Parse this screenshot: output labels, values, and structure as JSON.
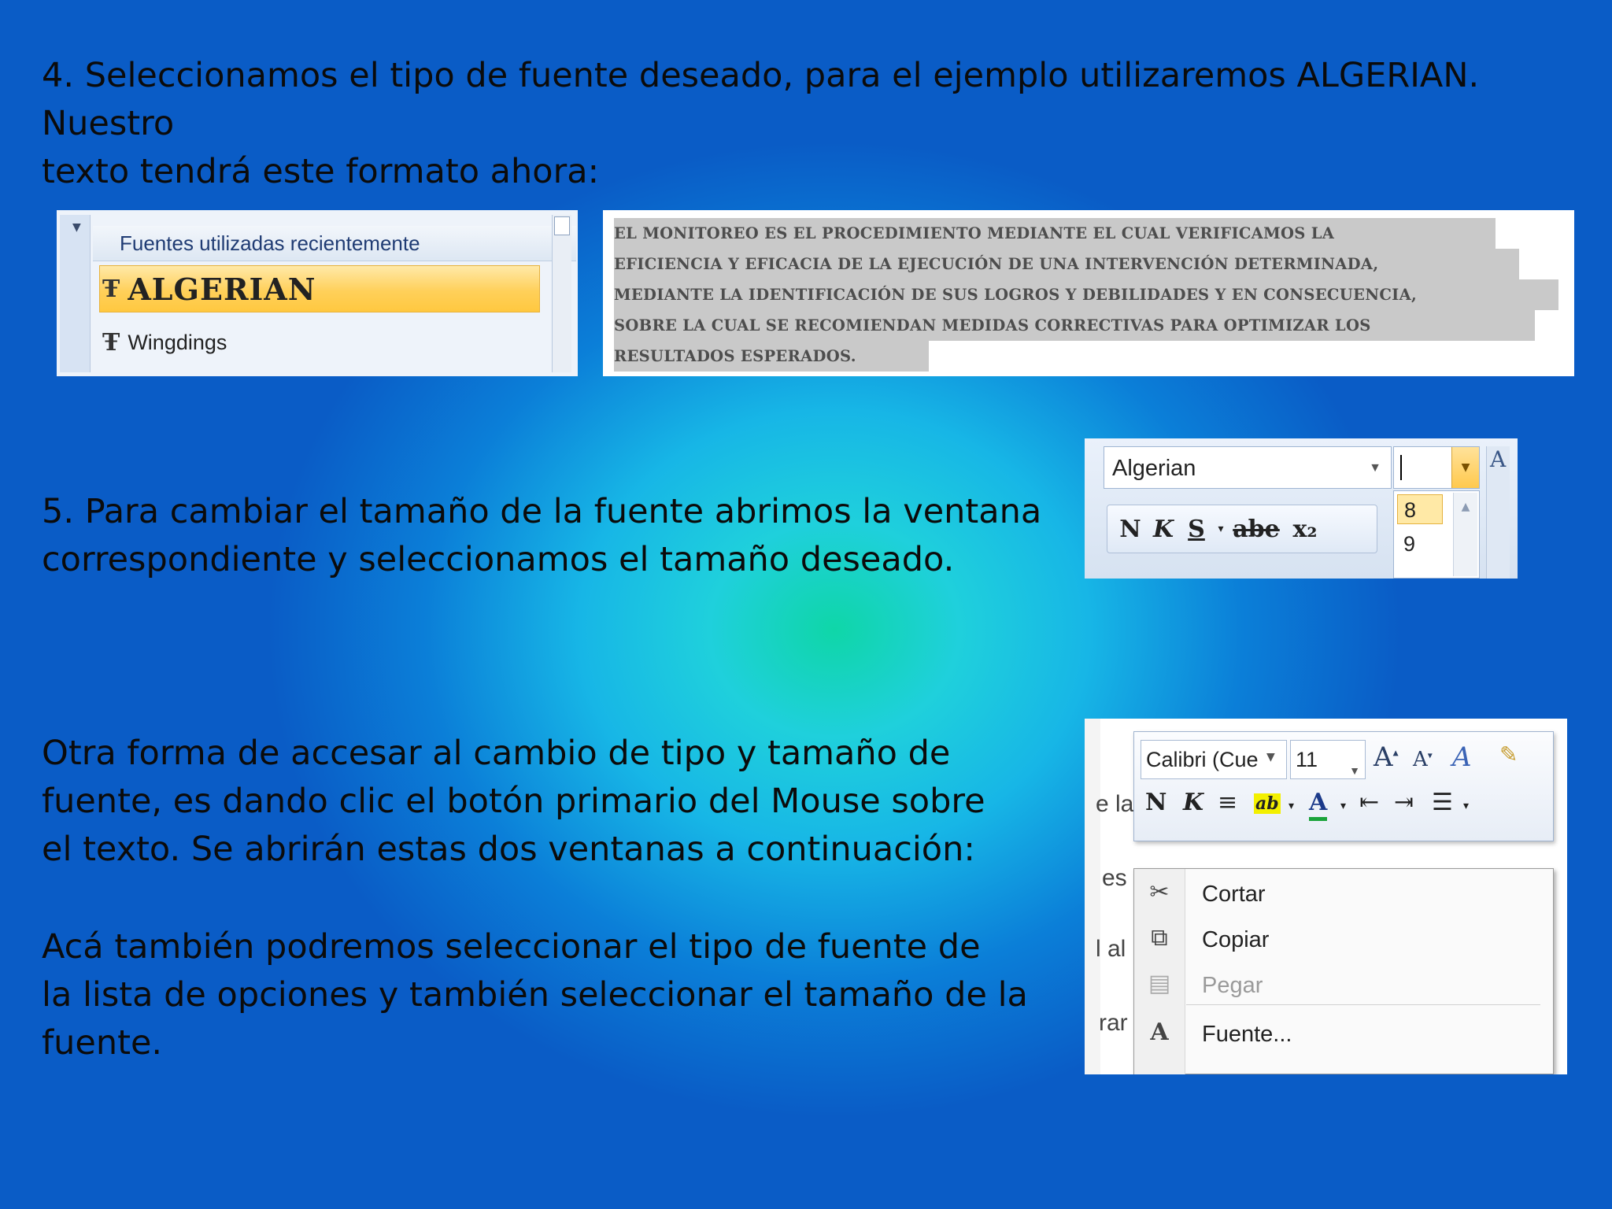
{
  "step4": {
    "line1": "4. Seleccionamos el tipo de fuente deseado, para el ejemplo utilizaremos ALGERIAN. Nuestro",
    "line2": "texto tendrá este formato ahora:"
  },
  "recent_fonts": {
    "header": "Fuentes utilizadas recientemente",
    "items": [
      {
        "label": "ALGERIAN",
        "selected": true
      },
      {
        "label": "Wingdings",
        "selected": false
      }
    ]
  },
  "sample_text": {
    "lines": [
      "EL MONITOREO ES EL PROCEDIMIENTO MEDIANTE EL CUAL VERIFICAMOS LA",
      "EFICIENCIA Y EFICACIA DE  LA EJECUCIÓN DE UNA INTERVENCIÓN DETERMINADA,",
      "MEDIANTE LA IDENTIFICACIÓN DE SUS LOGROS Y DEBILIDADES Y EN CONSECUENCIA,",
      "SOBRE LA CUAL SE RECOMIENDAN MEDIDAS CORRECTIVAS PARA OPTIMIZAR LOS",
      "RESULTADOS ESPERADOS."
    ]
  },
  "step5": {
    "line1": "5. Para cambiar el tamaño de la fuente abrimos la ventana",
    "line2": "correspondiente y seleccionamos el tamaño deseado."
  },
  "font_combo": {
    "font_name": "Algerian",
    "buttons": [
      "N",
      "K",
      "S",
      "abe",
      "x₂"
    ],
    "size_options": [
      "8",
      "9"
    ],
    "selected_size": "8"
  },
  "para_other": {
    "line1": "Otra forma de accesar al cambio de tipo y tamaño de",
    "line2": "fuente, es dando clic el botón primario del Mouse sobre",
    "line3": "el texto. Se abrirán estas dos ventanas a continuación:"
  },
  "para_also": {
    "line1": "Acá también podremos seleccionar el tipo de fuente de",
    "line2": "la lista de opciones y también seleccionar el tamaño de la",
    "line3": "fuente."
  },
  "mini_toolbar": {
    "font": "Calibri (Cue",
    "size": "11",
    "row2": [
      "N",
      "K"
    ]
  },
  "context_menu": {
    "items": [
      {
        "label": "Cortar",
        "icon": "scissors-icon",
        "disabled": false
      },
      {
        "label": "Copiar",
        "icon": "copy-icon",
        "disabled": false
      },
      {
        "label": "Pegar",
        "icon": "paste-icon",
        "disabled": true
      },
      {
        "label": "Fuente...",
        "icon": "font-icon",
        "disabled": false
      }
    ]
  },
  "doc_fragments": [
    "e la",
    "es",
    "l al",
    "rar"
  ],
  "colors": {
    "accent": "#0a5cc6",
    "highlight": "#ffd05a"
  }
}
